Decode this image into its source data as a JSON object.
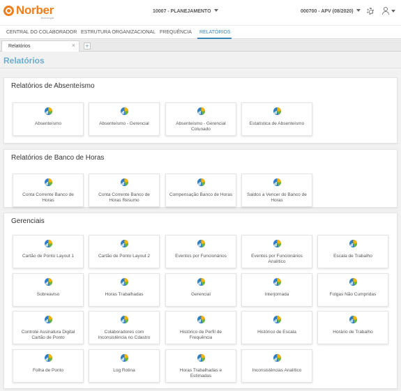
{
  "brand": {
    "name": "Norber",
    "tagline": "tecnologia"
  },
  "header": {
    "company": "10007 - PLANEJAMENTO",
    "period": "000700 - APV (08/2020)"
  },
  "nav": [
    {
      "label": "CENTRAL DO COLABORADOR"
    },
    {
      "label": "ESTRUTURA ORGANIZACIONAL"
    },
    {
      "label": "FREQUÊNCIA"
    },
    {
      "label": "RELATÓRIOS"
    }
  ],
  "tab": {
    "label": "Relatórios",
    "close": "×",
    "add": "+"
  },
  "page_title": "Relatórios",
  "sections": [
    {
      "title": "Relatórios de Absenteísmo",
      "cards": [
        {
          "label": "Absenteísmo"
        },
        {
          "label": "Absenteísmo - Gerencial"
        },
        {
          "label": "Absenteísmo - Gerencial Colunado"
        },
        {
          "label": "Estatística de Absenteísmo"
        }
      ]
    },
    {
      "title": "Relatórios de Banco de Horas",
      "cards": [
        {
          "label": "Conta Corrente Banco de Horas"
        },
        {
          "label": "Conta Corrente Banco de Horas Resumo"
        },
        {
          "label": "Compensação Banco de Horas"
        },
        {
          "label": "Saldos a Vencer do Banco de Horas"
        }
      ]
    },
    {
      "title": "Gerenciais",
      "cards": [
        {
          "label": "Cartão de Ponto Layout 1"
        },
        {
          "label": "Cartão de Ponto Layout 2"
        },
        {
          "label": "Eventos por Funcionários"
        },
        {
          "label": "Eventos por Funcionários Analítico"
        },
        {
          "label": "Escala de Trabalho"
        },
        {
          "label": "Sobreaviso"
        },
        {
          "label": "Horas Trabalhadas"
        },
        {
          "label": "Gerencial"
        },
        {
          "label": "Interjornada"
        },
        {
          "label": "Folgas Não Cumpridas"
        },
        {
          "label": "Controle Assinatura Digital Cartão de Ponto"
        },
        {
          "label": "Colaboradores com Inconsistência no Cdastro"
        },
        {
          "label": "Histórico de Perfil de Frequência"
        },
        {
          "label": "Histórico de Escala"
        },
        {
          "label": "Horário de Trabalho"
        },
        {
          "label": "Folha de Ponto"
        },
        {
          "label": "Log Rotina"
        },
        {
          "label": "Horas Trabalhadas e Estimadas"
        },
        {
          "label": "Inconsistências Analítico"
        }
      ]
    }
  ]
}
